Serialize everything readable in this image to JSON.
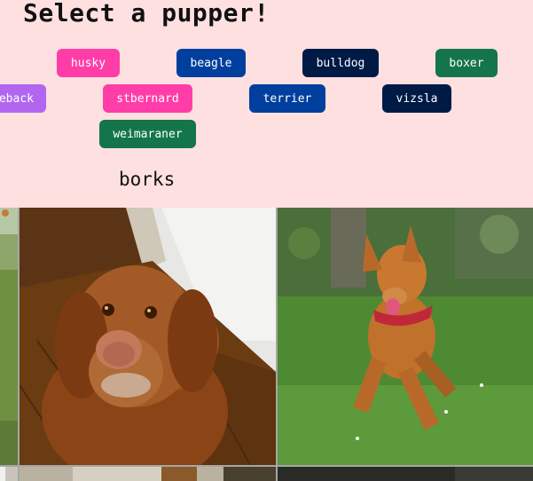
{
  "heading": "Select a pupper!",
  "breeds": [
    {
      "label": "husky",
      "color": "#ff3da8"
    },
    {
      "label": "beagle",
      "color": "#003f9e"
    },
    {
      "label": "bulldog",
      "color": "#001a46"
    },
    {
      "label": "boxer",
      "color": "#14754a"
    },
    {
      "label": "eback",
      "color": "#b266f0"
    },
    {
      "label": "stbernard",
      "color": "#ff3da8"
    },
    {
      "label": "terrier",
      "color": "#003f9e"
    },
    {
      "label": "vizsla",
      "color": "#001a46"
    },
    {
      "label": "weimaraner",
      "color": "#14754a"
    }
  ],
  "subheading": "borks",
  "colors": {
    "background": "#ffe0e0",
    "pink": "#ff3da8",
    "blue": "#003f9e",
    "navy": "#001a46",
    "green": "#14754a",
    "purple": "#b266f0"
  },
  "images": [
    {
      "name": "dog-photo-edge-left"
    },
    {
      "name": "vizsla-portrait-photo"
    },
    {
      "name": "vizsla-running-photo"
    },
    {
      "name": "dog-photo-bottom-left"
    },
    {
      "name": "dog-photo-bottom-center"
    },
    {
      "name": "dog-photo-bottom-right"
    }
  ]
}
